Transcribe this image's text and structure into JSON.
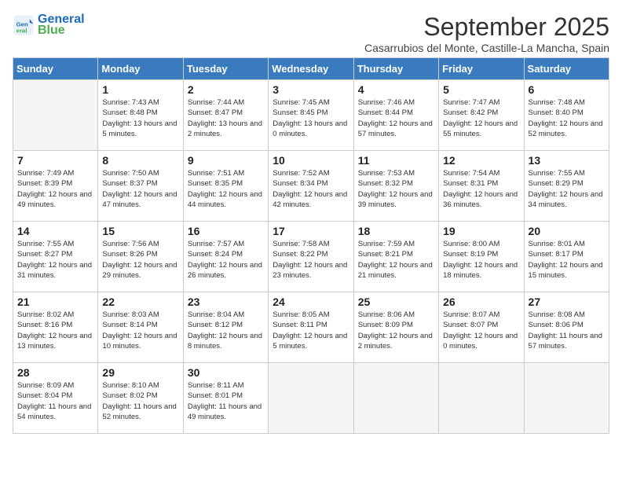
{
  "header": {
    "logo_line1": "General",
    "logo_line2": "Blue",
    "title": "September 2025",
    "subtitle": "Casarrubios del Monte, Castille-La Mancha, Spain"
  },
  "weekdays": [
    "Sunday",
    "Monday",
    "Tuesday",
    "Wednesday",
    "Thursday",
    "Friday",
    "Saturday"
  ],
  "weeks": [
    [
      {
        "day": "",
        "sunrise": "",
        "sunset": "",
        "daylight": "",
        "empty": true
      },
      {
        "day": "1",
        "sunrise": "Sunrise: 7:43 AM",
        "sunset": "Sunset: 8:48 PM",
        "daylight": "Daylight: 13 hours and 5 minutes."
      },
      {
        "day": "2",
        "sunrise": "Sunrise: 7:44 AM",
        "sunset": "Sunset: 8:47 PM",
        "daylight": "Daylight: 13 hours and 2 minutes."
      },
      {
        "day": "3",
        "sunrise": "Sunrise: 7:45 AM",
        "sunset": "Sunset: 8:45 PM",
        "daylight": "Daylight: 13 hours and 0 minutes."
      },
      {
        "day": "4",
        "sunrise": "Sunrise: 7:46 AM",
        "sunset": "Sunset: 8:44 PM",
        "daylight": "Daylight: 12 hours and 57 minutes."
      },
      {
        "day": "5",
        "sunrise": "Sunrise: 7:47 AM",
        "sunset": "Sunset: 8:42 PM",
        "daylight": "Daylight: 12 hours and 55 minutes."
      },
      {
        "day": "6",
        "sunrise": "Sunrise: 7:48 AM",
        "sunset": "Sunset: 8:40 PM",
        "daylight": "Daylight: 12 hours and 52 minutes."
      }
    ],
    [
      {
        "day": "7",
        "sunrise": "Sunrise: 7:49 AM",
        "sunset": "Sunset: 8:39 PM",
        "daylight": "Daylight: 12 hours and 49 minutes."
      },
      {
        "day": "8",
        "sunrise": "Sunrise: 7:50 AM",
        "sunset": "Sunset: 8:37 PM",
        "daylight": "Daylight: 12 hours and 47 minutes."
      },
      {
        "day": "9",
        "sunrise": "Sunrise: 7:51 AM",
        "sunset": "Sunset: 8:35 PM",
        "daylight": "Daylight: 12 hours and 44 minutes."
      },
      {
        "day": "10",
        "sunrise": "Sunrise: 7:52 AM",
        "sunset": "Sunset: 8:34 PM",
        "daylight": "Daylight: 12 hours and 42 minutes."
      },
      {
        "day": "11",
        "sunrise": "Sunrise: 7:53 AM",
        "sunset": "Sunset: 8:32 PM",
        "daylight": "Daylight: 12 hours and 39 minutes."
      },
      {
        "day": "12",
        "sunrise": "Sunrise: 7:54 AM",
        "sunset": "Sunset: 8:31 PM",
        "daylight": "Daylight: 12 hours and 36 minutes."
      },
      {
        "day": "13",
        "sunrise": "Sunrise: 7:55 AM",
        "sunset": "Sunset: 8:29 PM",
        "daylight": "Daylight: 12 hours and 34 minutes."
      }
    ],
    [
      {
        "day": "14",
        "sunrise": "Sunrise: 7:55 AM",
        "sunset": "Sunset: 8:27 PM",
        "daylight": "Daylight: 12 hours and 31 minutes."
      },
      {
        "day": "15",
        "sunrise": "Sunrise: 7:56 AM",
        "sunset": "Sunset: 8:26 PM",
        "daylight": "Daylight: 12 hours and 29 minutes."
      },
      {
        "day": "16",
        "sunrise": "Sunrise: 7:57 AM",
        "sunset": "Sunset: 8:24 PM",
        "daylight": "Daylight: 12 hours and 26 minutes."
      },
      {
        "day": "17",
        "sunrise": "Sunrise: 7:58 AM",
        "sunset": "Sunset: 8:22 PM",
        "daylight": "Daylight: 12 hours and 23 minutes."
      },
      {
        "day": "18",
        "sunrise": "Sunrise: 7:59 AM",
        "sunset": "Sunset: 8:21 PM",
        "daylight": "Daylight: 12 hours and 21 minutes."
      },
      {
        "day": "19",
        "sunrise": "Sunrise: 8:00 AM",
        "sunset": "Sunset: 8:19 PM",
        "daylight": "Daylight: 12 hours and 18 minutes."
      },
      {
        "day": "20",
        "sunrise": "Sunrise: 8:01 AM",
        "sunset": "Sunset: 8:17 PM",
        "daylight": "Daylight: 12 hours and 15 minutes."
      }
    ],
    [
      {
        "day": "21",
        "sunrise": "Sunrise: 8:02 AM",
        "sunset": "Sunset: 8:16 PM",
        "daylight": "Daylight: 12 hours and 13 minutes."
      },
      {
        "day": "22",
        "sunrise": "Sunrise: 8:03 AM",
        "sunset": "Sunset: 8:14 PM",
        "daylight": "Daylight: 12 hours and 10 minutes."
      },
      {
        "day": "23",
        "sunrise": "Sunrise: 8:04 AM",
        "sunset": "Sunset: 8:12 PM",
        "daylight": "Daylight: 12 hours and 8 minutes."
      },
      {
        "day": "24",
        "sunrise": "Sunrise: 8:05 AM",
        "sunset": "Sunset: 8:11 PM",
        "daylight": "Daylight: 12 hours and 5 minutes."
      },
      {
        "day": "25",
        "sunrise": "Sunrise: 8:06 AM",
        "sunset": "Sunset: 8:09 PM",
        "daylight": "Daylight: 12 hours and 2 minutes."
      },
      {
        "day": "26",
        "sunrise": "Sunrise: 8:07 AM",
        "sunset": "Sunset: 8:07 PM",
        "daylight": "Daylight: 12 hours and 0 minutes."
      },
      {
        "day": "27",
        "sunrise": "Sunrise: 8:08 AM",
        "sunset": "Sunset: 8:06 PM",
        "daylight": "Daylight: 11 hours and 57 minutes."
      }
    ],
    [
      {
        "day": "28",
        "sunrise": "Sunrise: 8:09 AM",
        "sunset": "Sunset: 8:04 PM",
        "daylight": "Daylight: 11 hours and 54 minutes."
      },
      {
        "day": "29",
        "sunrise": "Sunrise: 8:10 AM",
        "sunset": "Sunset: 8:02 PM",
        "daylight": "Daylight: 11 hours and 52 minutes."
      },
      {
        "day": "30",
        "sunrise": "Sunrise: 8:11 AM",
        "sunset": "Sunset: 8:01 PM",
        "daylight": "Daylight: 11 hours and 49 minutes."
      },
      {
        "day": "",
        "sunrise": "",
        "sunset": "",
        "daylight": "",
        "empty": true
      },
      {
        "day": "",
        "sunrise": "",
        "sunset": "",
        "daylight": "",
        "empty": true
      },
      {
        "day": "",
        "sunrise": "",
        "sunset": "",
        "daylight": "",
        "empty": true
      },
      {
        "day": "",
        "sunrise": "",
        "sunset": "",
        "daylight": "",
        "empty": true
      }
    ]
  ]
}
